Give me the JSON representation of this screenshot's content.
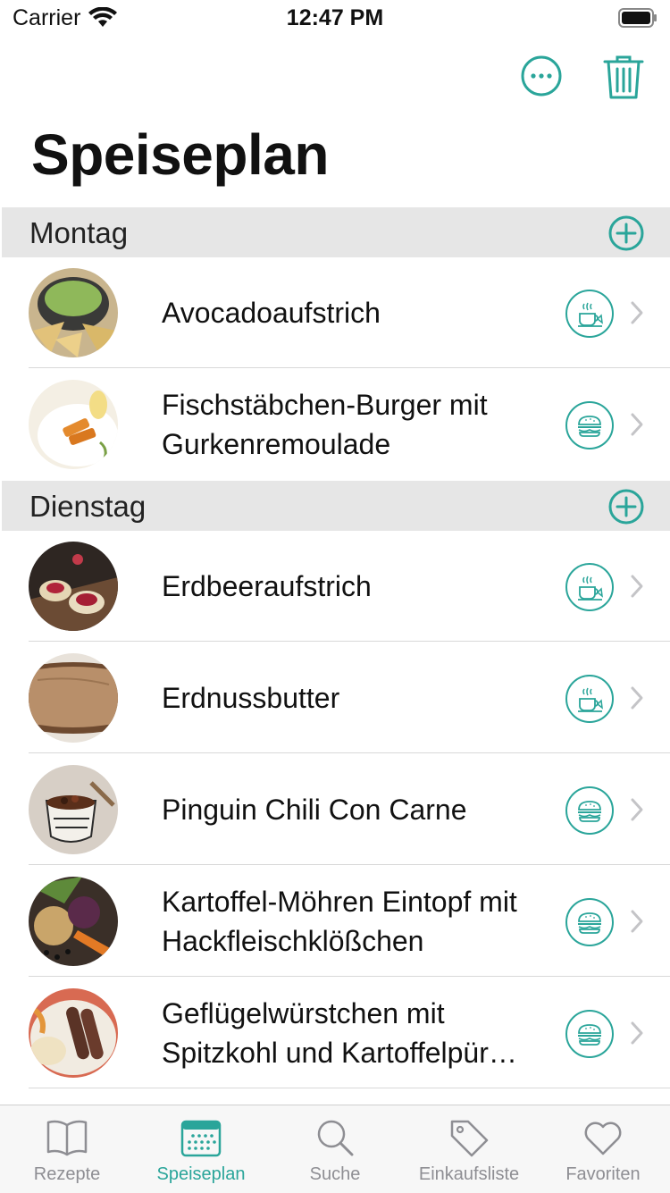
{
  "status_bar": {
    "carrier": "Carrier",
    "time": "12:47 PM"
  },
  "page_title": "Speiseplan",
  "accent_color": "#2aa59a",
  "nav": {
    "more_icon": "ellipsis-circle-icon",
    "delete_icon": "trash-icon"
  },
  "sections": [
    {
      "label": "Montag",
      "items": [
        {
          "title": "Avocadoaufstrich",
          "meal_icon": "breakfast-icon",
          "image": "guacamole-bowl"
        },
        {
          "title": "Fischstäbchen-Burger mit Gurkenremoulade",
          "meal_icon": "burger-icon",
          "image": "fish-sticks-plate"
        }
      ]
    },
    {
      "label": "Dienstag",
      "items": [
        {
          "title": "Erdbeeraufstrich",
          "meal_icon": "breakfast-icon",
          "image": "strawberry-spread"
        },
        {
          "title": "Erdnussbutter",
          "meal_icon": "breakfast-icon",
          "image": "peanut-butter-bread"
        },
        {
          "title": "Pinguin Chili Con Carne",
          "meal_icon": "burger-icon",
          "image": "chili-bowl"
        },
        {
          "title": "Kartoffel-Möhren Eintopf mit Hackfleischklößchen",
          "meal_icon": "burger-icon",
          "image": "vegetables"
        },
        {
          "title": "Geflügelwürstchen mit Spitzkohl und Kartoffelpür…",
          "meal_icon": "burger-icon",
          "image": "sausages-plate"
        }
      ]
    }
  ],
  "tabs": [
    {
      "label": "Rezepte",
      "icon": "book-icon",
      "active": false
    },
    {
      "label": "Speiseplan",
      "icon": "calendar-icon",
      "active": true
    },
    {
      "label": "Suche",
      "icon": "search-icon",
      "active": false
    },
    {
      "label": "Einkaufsliste",
      "icon": "tag-icon",
      "active": false
    },
    {
      "label": "Favoriten",
      "icon": "heart-icon",
      "active": false
    }
  ]
}
